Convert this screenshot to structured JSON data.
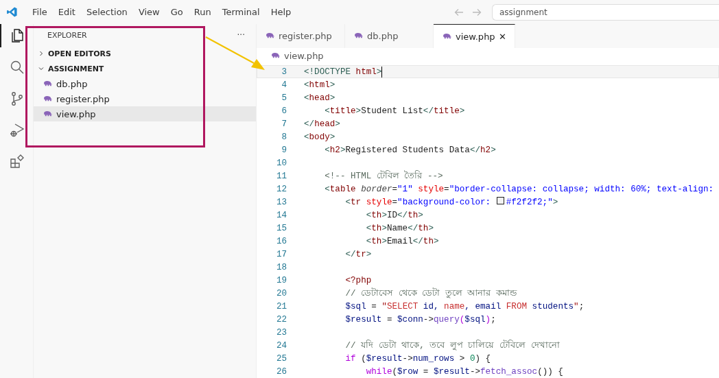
{
  "menu": [
    "File",
    "Edit",
    "Selection",
    "View",
    "Go",
    "Run",
    "Terminal",
    "Help"
  ],
  "command_center": {
    "value": "assignment"
  },
  "activity_bar": [
    {
      "kind": "files",
      "selected": true
    },
    {
      "kind": "search",
      "selected": false
    },
    {
      "kind": "source-control",
      "selected": false
    },
    {
      "kind": "run-debug",
      "selected": false
    },
    {
      "kind": "extensions",
      "selected": false
    }
  ],
  "sidebar": {
    "title": "EXPLORER",
    "more": "···",
    "sections": [
      {
        "label": "OPEN EDITORS",
        "expanded": false
      },
      {
        "label": "ASSIGNMENT",
        "expanded": true,
        "children": [
          {
            "label": "db.php",
            "selected": false
          },
          {
            "label": "register.php",
            "selected": false
          },
          {
            "label": "view.php",
            "selected": true
          }
        ]
      }
    ]
  },
  "tabs": [
    {
      "label": "register.php",
      "selected": false
    },
    {
      "label": "db.php",
      "selected": false
    },
    {
      "label": "view.php",
      "selected": true,
      "close": "✕"
    }
  ],
  "breadcrumb": "view.php",
  "lines": [
    {
      "number": "3",
      "current": true,
      "tokens": [
        {
          "kind": "p",
          "text": "<!DOCTYPE "
        },
        {
          "kind": "tag",
          "text": "html"
        },
        {
          "kind": "p",
          "text": ">"
        }
      ]
    },
    {
      "number": "4",
      "current": false,
      "tokens": [
        {
          "kind": "p",
          "text": "<"
        },
        {
          "kind": "tag",
          "text": "html"
        },
        {
          "kind": "p",
          "text": ">"
        }
      ]
    },
    {
      "number": "5",
      "current": false,
      "tokens": [
        {
          "kind": "p",
          "text": "<"
        },
        {
          "kind": "tag",
          "text": "head"
        },
        {
          "kind": "p",
          "text": ">"
        }
      ]
    },
    {
      "number": "6",
      "current": false,
      "tokens": [
        {
          "kind": "p",
          "text": "    <"
        },
        {
          "kind": "tag",
          "text": "title"
        },
        {
          "kind": "p",
          "text": ">"
        },
        {
          "kind": "text",
          "text": "Student List"
        },
        {
          "kind": "p",
          "text": "</"
        },
        {
          "kind": "tag",
          "text": "title"
        },
        {
          "kind": "p",
          "text": ">"
        }
      ]
    },
    {
      "number": "7",
      "current": false,
      "tokens": [
        {
          "kind": "p",
          "text": "</"
        },
        {
          "kind": "tag",
          "text": "head"
        },
        {
          "kind": "p",
          "text": ">"
        }
      ]
    },
    {
      "number": "8",
      "current": false,
      "tokens": [
        {
          "kind": "p",
          "text": "<"
        },
        {
          "kind": "tag",
          "text": "body"
        },
        {
          "kind": "p",
          "text": ">"
        }
      ]
    },
    {
      "number": "9",
      "current": false,
      "tokens": [
        {
          "kind": "p",
          "text": "    <"
        },
        {
          "kind": "tag",
          "text": "h2"
        },
        {
          "kind": "p",
          "text": ">"
        },
        {
          "kind": "text",
          "text": "Registered Students Data"
        },
        {
          "kind": "p",
          "text": "</"
        },
        {
          "kind": "tag",
          "text": "h2"
        },
        {
          "kind": "p",
          "text": ">"
        }
      ]
    },
    {
      "number": "10",
      "current": false
    },
    {
      "number": "11",
      "current": false,
      "tokens": [
        {
          "kind": "comment",
          "text": "    <!-- HTML টেবিল তৈরি -->"
        }
      ]
    },
    {
      "number": "12",
      "current": false,
      "tokens": [
        {
          "kind": "p",
          "text": "    <"
        },
        {
          "kind": "tag",
          "text": "table"
        },
        {
          "kind": "attr-italic",
          "text": " border"
        },
        {
          "kind": "text",
          "text": "="
        },
        {
          "kind": "string",
          "text": "\"1\""
        },
        {
          "kind": "attr",
          "text": " style"
        },
        {
          "kind": "text",
          "text": "="
        },
        {
          "kind": "string",
          "text": "\"border-collapse: collapse; width: 60%; text-align:"
        }
      ]
    },
    {
      "number": "13",
      "current": false,
      "tokens": [
        {
          "kind": "p",
          "text": "        <"
        },
        {
          "kind": "tag",
          "text": "tr"
        },
        {
          "kind": "attr",
          "text": " style"
        },
        {
          "kind": "text",
          "text": "="
        },
        {
          "kind": "string",
          "text": "\"background-color: "
        },
        {
          "kind": "swatch",
          "color": "#f2f2f2"
        },
        {
          "kind": "string",
          "text": "#f2f2f2;\""
        },
        {
          "kind": "p",
          "text": ">"
        }
      ]
    },
    {
      "number": "14",
      "current": false,
      "tokens": [
        {
          "kind": "p",
          "text": "            <"
        },
        {
          "kind": "tag",
          "text": "th"
        },
        {
          "kind": "p",
          "text": ">"
        },
        {
          "kind": "text",
          "text": "ID"
        },
        {
          "kind": "p",
          "text": "</"
        },
        {
          "kind": "tag",
          "text": "th"
        },
        {
          "kind": "p",
          "text": ">"
        }
      ]
    },
    {
      "number": "15",
      "current": false,
      "tokens": [
        {
          "kind": "p",
          "text": "            <"
        },
        {
          "kind": "tag",
          "text": "th"
        },
        {
          "kind": "p",
          "text": ">"
        },
        {
          "kind": "text",
          "text": "Name"
        },
        {
          "kind": "p",
          "text": "</"
        },
        {
          "kind": "tag",
          "text": "th"
        },
        {
          "kind": "p",
          "text": ">"
        }
      ]
    },
    {
      "number": "16",
      "current": false,
      "tokens": [
        {
          "kind": "p",
          "text": "            <"
        },
        {
          "kind": "tag",
          "text": "th"
        },
        {
          "kind": "p",
          "text": ">"
        },
        {
          "kind": "text",
          "text": "Email"
        },
        {
          "kind": "p",
          "text": "</"
        },
        {
          "kind": "tag",
          "text": "th"
        },
        {
          "kind": "p",
          "text": ">"
        }
      ]
    },
    {
      "number": "17",
      "current": false,
      "tokens": [
        {
          "kind": "p",
          "text": "        </"
        },
        {
          "kind": "tag",
          "text": "tr"
        },
        {
          "kind": "p",
          "text": ">"
        }
      ]
    },
    {
      "number": "18",
      "current": false
    },
    {
      "number": "19",
      "current": false,
      "tokens": [
        {
          "kind": "tag",
          "text": "        <?php"
        }
      ]
    },
    {
      "number": "20",
      "current": false,
      "tokens": [
        {
          "kind": "comment",
          "text": "        // ডেটাবেস থেকে ডেটা তুলে আনার কমান্ড"
        }
      ]
    },
    {
      "number": "21",
      "current": false,
      "tokens": [
        {
          "kind": "var",
          "text": "        $sql"
        },
        {
          "kind": "text",
          "text": " = "
        },
        {
          "kind": "sqlstr",
          "text": "\""
        },
        {
          "kind": "sql",
          "text": "SELECT"
        },
        {
          "kind": "var",
          "text": " id, "
        },
        {
          "kind": "sql",
          "text": "name"
        },
        {
          "kind": "var",
          "text": ", email "
        },
        {
          "kind": "sql",
          "text": "FROM"
        },
        {
          "kind": "var",
          "text": " students"
        },
        {
          "kind": "sqlstr",
          "text": "\""
        },
        {
          "kind": "text",
          "text": ";"
        }
      ]
    },
    {
      "number": "22",
      "current": false,
      "tokens": [
        {
          "kind": "var",
          "text": "        $result"
        },
        {
          "kind": "text",
          "text": " = "
        },
        {
          "kind": "var",
          "text": "$conn"
        },
        {
          "kind": "text",
          "text": "->"
        },
        {
          "kind": "fn",
          "text": "query"
        },
        {
          "kind": "keyword",
          "text": "("
        },
        {
          "kind": "var",
          "text": "$sql"
        },
        {
          "kind": "keyword",
          "text": ")"
        },
        {
          "kind": "text",
          "text": ";"
        }
      ]
    },
    {
      "number": "23",
      "current": false
    },
    {
      "number": "24",
      "current": false,
      "tokens": [
        {
          "kind": "comment",
          "text": "        // যদি ডেটা থাকে, তবে লুপ চালিয়ে টেবিলে দেখানো"
        }
      ]
    },
    {
      "number": "25",
      "current": false,
      "tokens": [
        {
          "kind": "keyword",
          "text": "        if"
        },
        {
          "kind": "text",
          "text": " ("
        },
        {
          "kind": "var",
          "text": "$result"
        },
        {
          "kind": "text",
          "text": "->"
        },
        {
          "kind": "var",
          "text": "num_rows"
        },
        {
          "kind": "text",
          "text": " > "
        },
        {
          "kind": "num",
          "text": "0"
        },
        {
          "kind": "text",
          "text": ") {"
        }
      ]
    },
    {
      "number": "26",
      "current": false,
      "tokens": [
        {
          "kind": "keyword",
          "text": "            while"
        },
        {
          "kind": "text",
          "text": "("
        },
        {
          "kind": "var",
          "text": "$row"
        },
        {
          "kind": "text",
          "text": " = "
        },
        {
          "kind": "var",
          "text": "$result"
        },
        {
          "kind": "text",
          "text": "->"
        },
        {
          "kind": "fn",
          "text": "fetch_assoc"
        },
        {
          "kind": "text",
          "text": "()) {"
        }
      ]
    }
  ]
}
